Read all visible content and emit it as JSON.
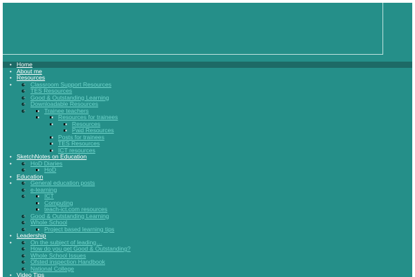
{
  "nav": {
    "home": "Home",
    "about": "About me",
    "resources": {
      "label": "Resources",
      "items": {
        "classroom": "Classroom Support Resources",
        "tes": "TES Resources",
        "good": "Good & Outstanding Learning",
        "downloadable": {
          "label": "Downloadable Resources",
          "trainee": {
            "label": "Trainee teachers",
            "for_trainees": {
              "label": "Resources for trainees",
              "resources": "Resources",
              "paid": "Paid Resources"
            },
            "posts": "Posts for trainees",
            "tes": "TES Resources",
            "ict": "ICT resources"
          }
        }
      }
    },
    "sketchnotes": {
      "label": "SketchNotes on Education",
      "hod_diaries": "HoD Diaries",
      "hod": "HoD"
    },
    "education": {
      "label": "Education",
      "general": "General education posts",
      "elearning": "e-learning",
      "ict": "ICT",
      "computing": "Computing",
      "teach_ict": "teach-ict.com resources",
      "good": "Good & Outstanding Learning",
      "whole_school": "Whole School",
      "project": "Project based learning tips"
    },
    "leadership": {
      "label": "Leadership",
      "subject": "On the subject of leading…",
      "how": "How do you get Good & Outstanding?",
      "whole_school": "Whole School Issues",
      "ofsted": "Ofsted inspection Handbook",
      "national": "National College"
    },
    "video": "Video Tips"
  }
}
